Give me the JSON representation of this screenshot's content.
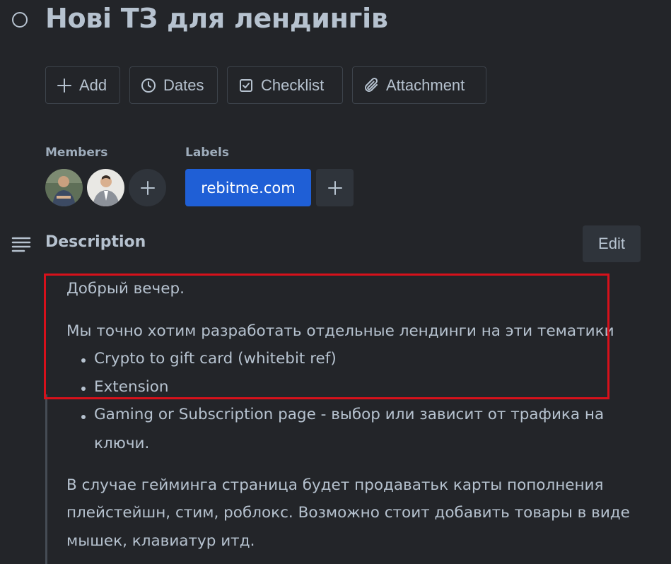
{
  "card": {
    "title": "Нові ТЗ для лендингів"
  },
  "actions": {
    "add": "Add",
    "dates": "Dates",
    "checklist": "Checklist",
    "attachment": "Attachment"
  },
  "members": {
    "label": "Members",
    "add_icon": "plus-icon"
  },
  "labels": {
    "label": "Labels",
    "chips": [
      {
        "text": "rebitme.com",
        "color": "#1f5fd6"
      }
    ]
  },
  "description": {
    "heading": "Description",
    "edit_label": "Edit",
    "greeting": "Добрый вечер.",
    "intro": "Мы точно хотим разработать отдельные лендинги на эти тематики",
    "bullets": [
      "Crypto to gift card (whitebit ref)",
      "Extension",
      "Gaming or Subscription page - выбор или  зависит от трафика на",
      "ключи."
    ],
    "paragraph_lines": [
      "В случае гейминга страница будет продаватьк карты пополнения",
      "плейстейшн, стим, роблокс. Возможно стоит добавить товары в виде",
      "мышек, клавиатур итд."
    ]
  },
  "colors": {
    "background": "#232529",
    "text": "#b6c2cf",
    "label_chip": "#1f5fd6",
    "highlight": "#d6111b"
  }
}
